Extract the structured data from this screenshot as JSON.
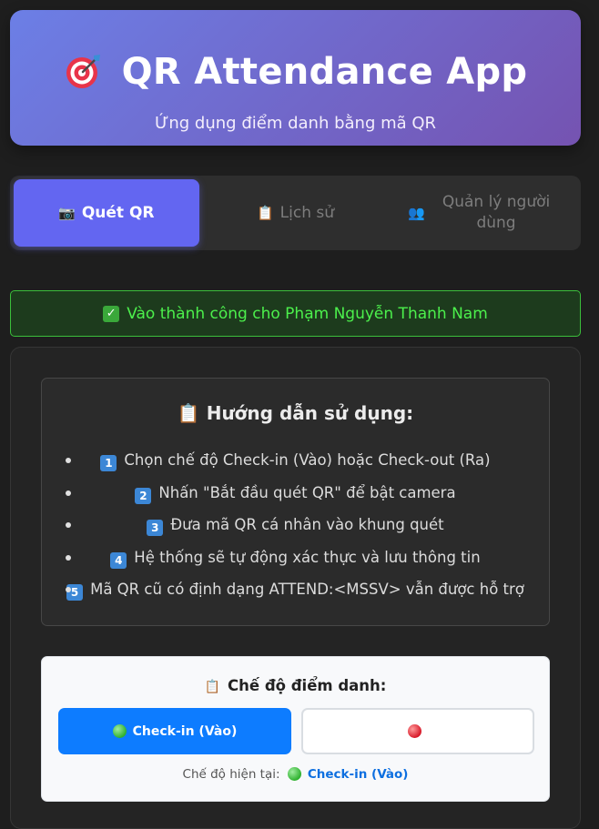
{
  "header": {
    "title": "QR Attendance App",
    "subtitle": "Ứng dụng điểm danh bằng mã QR",
    "icon": "target-icon"
  },
  "tabs": [
    {
      "label": "Quét QR",
      "icon": "camera-icon",
      "active": true
    },
    {
      "label": "Lịch sử",
      "icon": "clipboard-icon",
      "active": false
    },
    {
      "label": "Quản lý người dùng",
      "icon": "users-icon",
      "active": false
    }
  ],
  "alert": {
    "text": "Vào thành công cho Phạm Nguyễn Thanh Nam",
    "icon": "check-icon"
  },
  "guide": {
    "title": "Hướng dẫn sử dụng:",
    "items": [
      {
        "num": "1",
        "text": "Chọn chế độ Check-in (Vào) hoặc Check-out (Ra)"
      },
      {
        "num": "2",
        "text": "Nhấn \"Bắt đầu quét QR\" để bật camera"
      },
      {
        "num": "3",
        "text": "Đưa mã QR cá nhân vào khung quét"
      },
      {
        "num": "4",
        "text": "Hệ thống sẽ tự động xác thực và lưu thông tin"
      },
      {
        "num": "5",
        "text": "Mã QR cũ có định dạng ATTEND:<MSSV> vẫn được hỗ trợ"
      }
    ]
  },
  "mode": {
    "title": "Chế độ điểm danh:",
    "checkin_label": "Check-in (Vào)",
    "checkout_label": "",
    "current_prefix": "Chế độ hiện tại:",
    "current_value": "Check-in (Vào)"
  },
  "colors": {
    "accent": "#6366f1",
    "checkin": "#0d7cff",
    "success": "#4cf04c"
  }
}
